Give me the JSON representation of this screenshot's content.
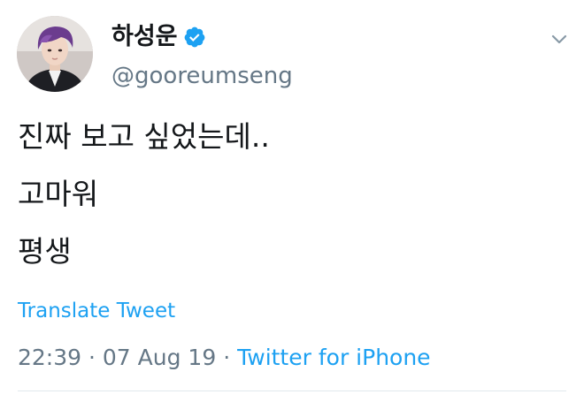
{
  "user": {
    "display_name": "하성운",
    "handle": "@gooreumseng",
    "verified": true,
    "avatar_icon": "profile-avatar",
    "verified_icon": "verified-badge-icon",
    "verified_color": "#1da1f2"
  },
  "tweet": {
    "lines": [
      "진짜 보고 싶었는데..",
      "고마워",
      "평생"
    ],
    "translate_label": "Translate Tweet",
    "time": "22:39",
    "date": "07 Aug 19",
    "separator": "·",
    "source": "Twitter for iPhone"
  },
  "icons": {
    "menu": "chevron-down-icon"
  },
  "colors": {
    "text": "#14171a",
    "secondary": "#657786",
    "accent": "#1da1f2",
    "divider": "#e1e8ed"
  }
}
